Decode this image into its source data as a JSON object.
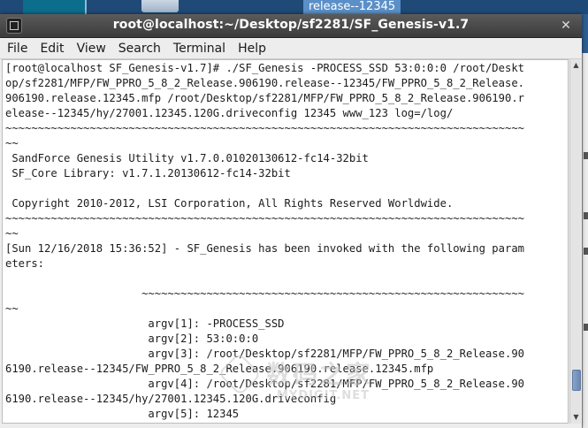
{
  "desktop": {
    "icon_label": "release--12345"
  },
  "window": {
    "title": "root@localhost:~/Desktop/sf2281/SF_Genesis-v1.7",
    "close_glyph": "✕"
  },
  "menu": {
    "items": [
      "File",
      "Edit",
      "View",
      "Search",
      "Terminal",
      "Help"
    ]
  },
  "terminal": {
    "lines": [
      "[root@localhost SF_Genesis-v1.7]# ./SF_Genesis -PROCESS_SSD 53:0:0:0 /root/Deskt",
      "op/sf2281/MFP/FW_PPRO_5_8_2_Release.906190.release--12345/FW_PPRO_5_8_2_Release.",
      "906190.release.12345.mfp /root/Desktop/sf2281/MFP/FW_PPRO_5_8_2_Release.906190.r",
      "elease--12345/hy/27001.12345.120G.driveconfig 12345 www_123 log=/log/",
      "~~~~~~~~~~~~~~~~~~~~~~~~~~~~~~~~~~~~~~~~~~~~~~~~~~~~~~~~~~~~~~~~~~~~~~~~~~~~~~~~",
      "~~",
      " SandForce Genesis Utility v1.7.0.01020130612-fc14-32bit",
      " SF_Core Library: v1.7.1.20130612-fc14-32bit",
      "",
      " Copyright 2010-2012, LSI Corporation, All Rights Reserved Worldwide.",
      "~~~~~~~~~~~~~~~~~~~~~~~~~~~~~~~~~~~~~~~~~~~~~~~~~~~~~~~~~~~~~~~~~~~~~~~~~~~~~~~~",
      "~~",
      "[Sun 12/16/2018 15:36:52] - SF_Genesis has been invoked with the following param",
      "eters:",
      "",
      "                     ~~~~~~~~~~~~~~~~~~~~~~~~~~~~~~~~~~~~~~~~~~~~~~~~~~~~~~~~~~~",
      "~~",
      "                      argv[1]: -PROCESS_SSD",
      "                      argv[2]: 53:0:0:0",
      "                      argv[3]: /root/Desktop/sf2281/MFP/FW_PPRO_5_8_2_Release.90",
      "6190.release--12345/FW_PPRO_5_8_2_Release.906190.release.12345.mfp",
      "                      argv[4]: /root/Desktop/sf2281/MFP/FW_PPRO_5_8_2_Release.90",
      "6190.release--12345/hy/27001.12345.120G.driveconfig",
      "                      argv[5]: 12345"
    ]
  },
  "watermark": {
    "big": "数码之家",
    "small": "MYDIGIT.NET"
  },
  "scrollbar": {
    "position": 0.93
  }
}
